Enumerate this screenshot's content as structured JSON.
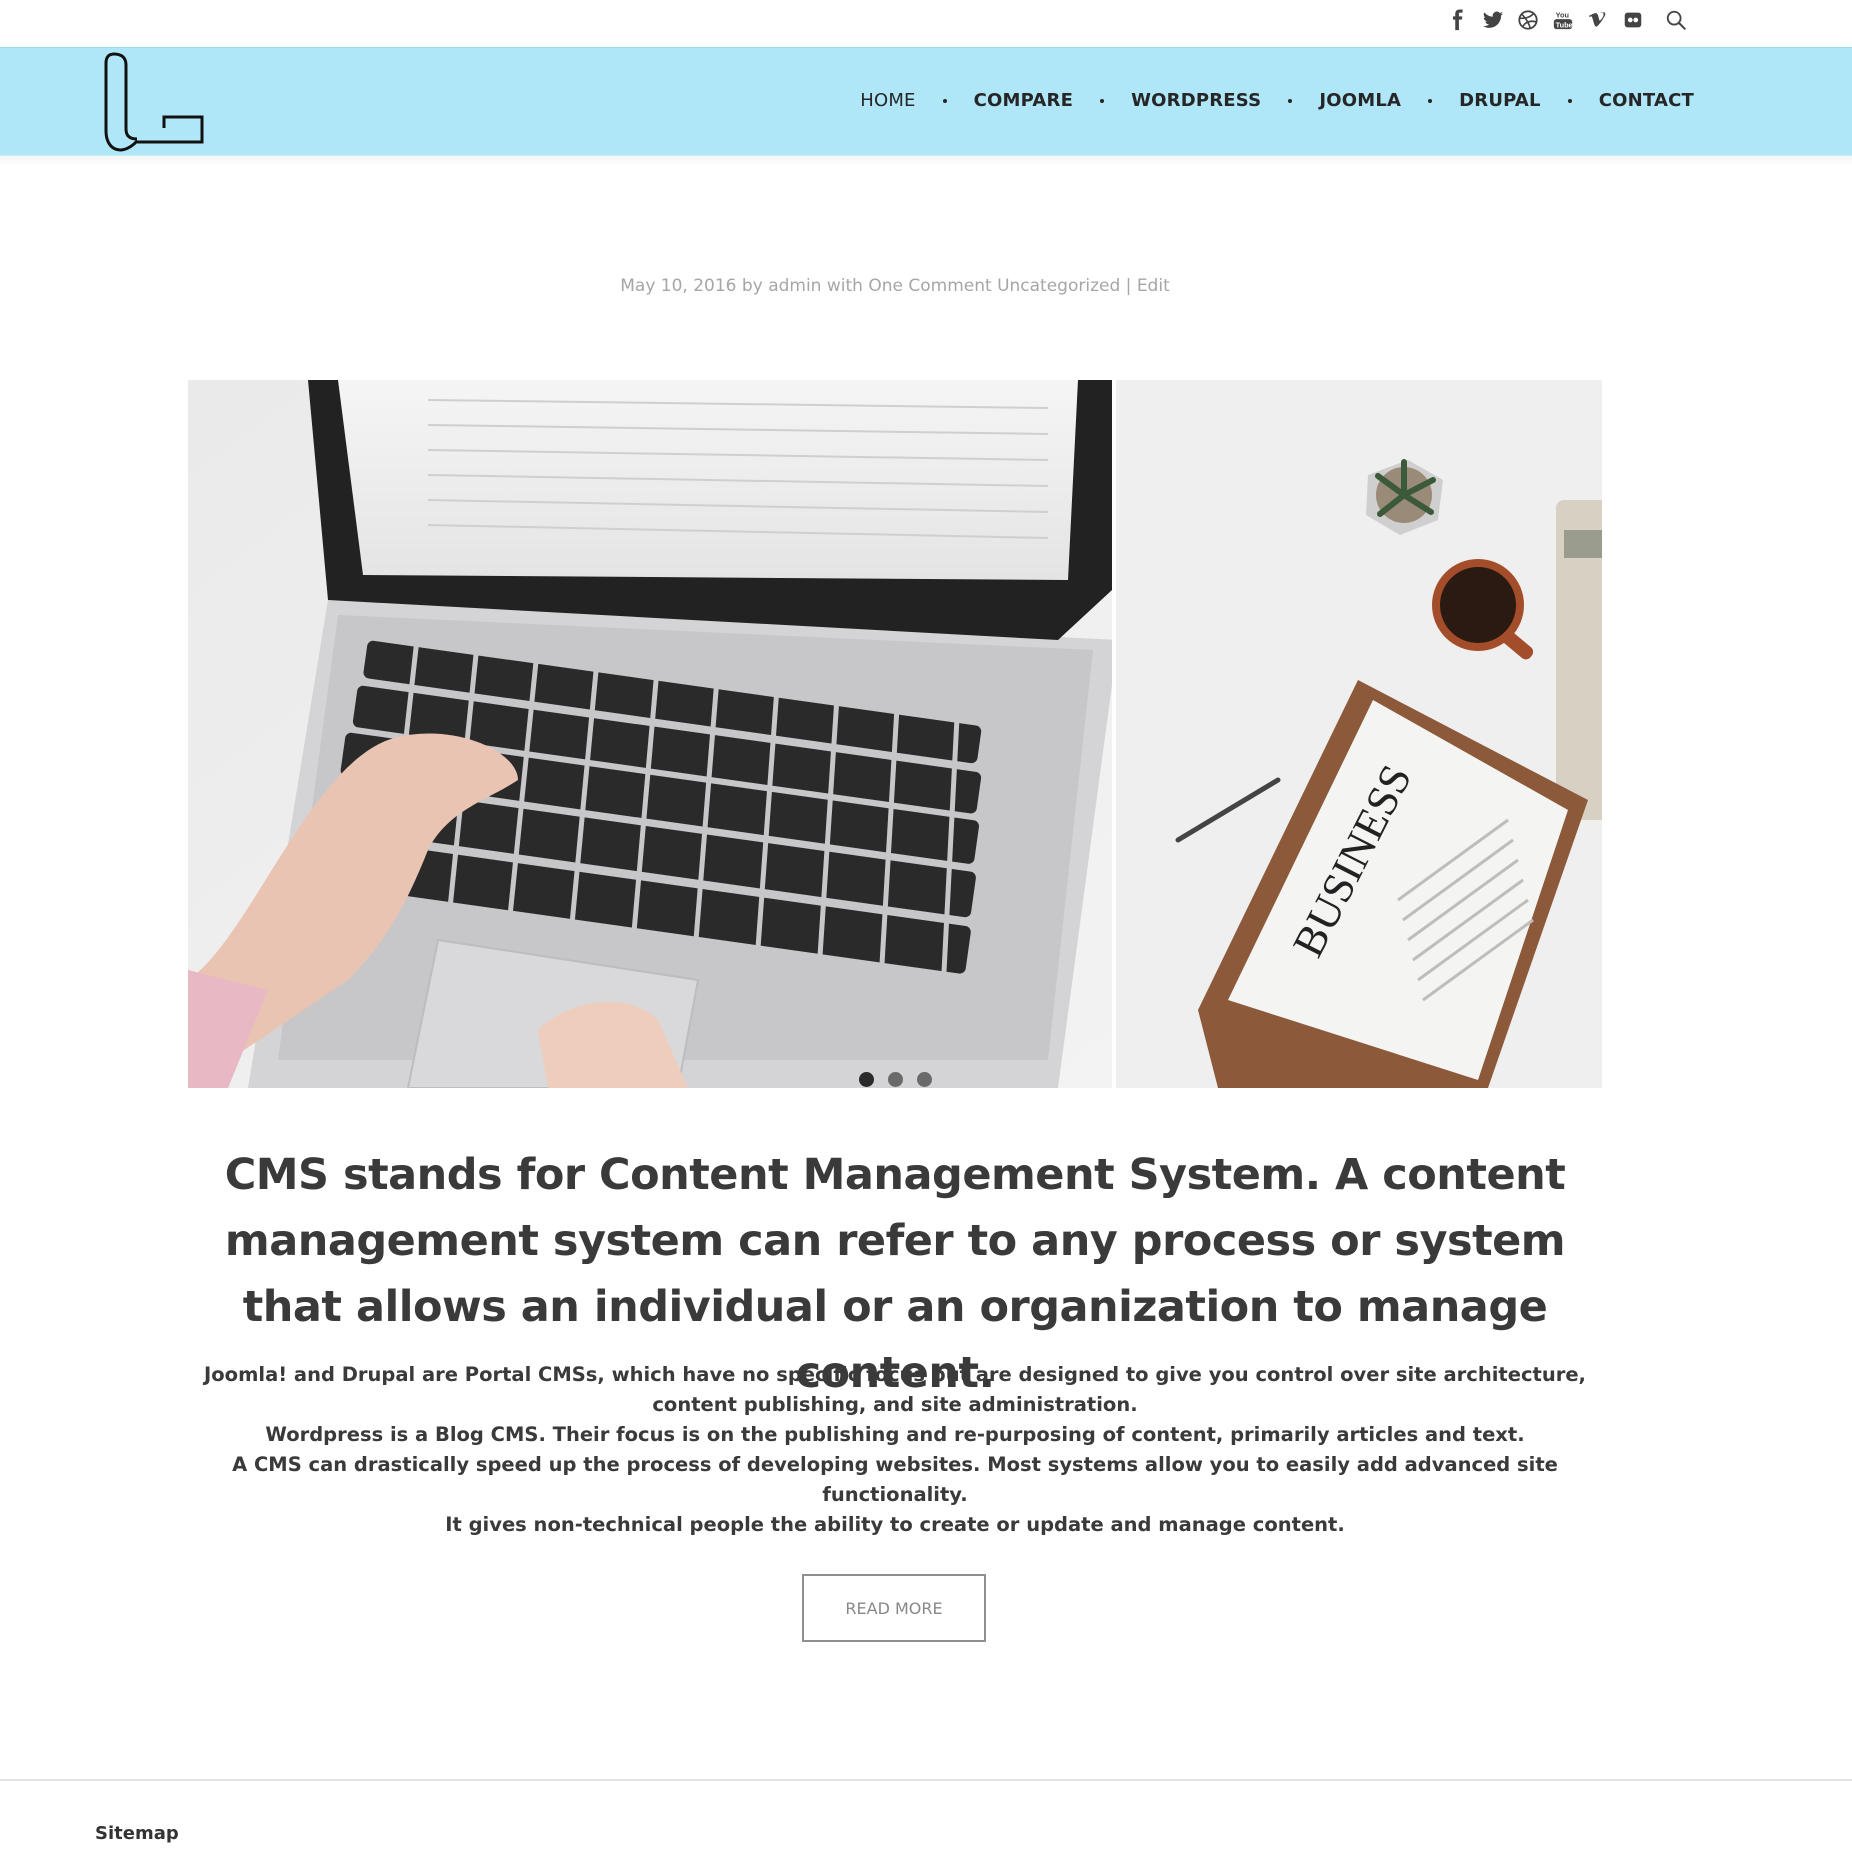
{
  "social": {
    "icons": [
      "facebook-icon",
      "twitter-icon",
      "dribbble-icon",
      "youtube-icon",
      "vimeo-icon",
      "flickr-icon",
      "search-icon"
    ]
  },
  "nav": {
    "items": [
      {
        "label": "HOME"
      },
      {
        "label": "COMPARE"
      },
      {
        "label": "WORDPRESS"
      },
      {
        "label": "JOOMLA"
      },
      {
        "label": "DRUPAL"
      },
      {
        "label": "CONTACT"
      }
    ]
  },
  "post": {
    "date": "May 10, 2016",
    "by": "by",
    "author": "admin",
    "with": "with",
    "comments": "One Comment",
    "category": "Uncategorized",
    "separator": "|",
    "edit": "Edit",
    "slider": {
      "slide_count": 3,
      "active_slide": 1
    },
    "headline": "CMS stands for Content Management System. A content management system can refer to any process or system that allows an individual or an organization to manage content.",
    "paragraphs": [
      "Joomla! and Drupal are Portal CMSs, which have no specific focus but are designed to give you control over site architecture, content publishing, and site administration.",
      "Wordpress is a Blog CMS. Their focus is on the publishing and re-purposing of content, primarily articles and text.",
      "A CMS can drastically speed up the process of developing websites. Most systems allow you to easily add advanced site functionality.",
      "It gives non-technical people the ability to create or update and manage content."
    ],
    "read_more": "READ MORE"
  },
  "footer": {
    "sitemap": "Sitemap"
  },
  "colors": {
    "header_bg": "#afe7f9",
    "text_dark": "#3a3a3a",
    "meta_gray": "#a6a6a6"
  }
}
